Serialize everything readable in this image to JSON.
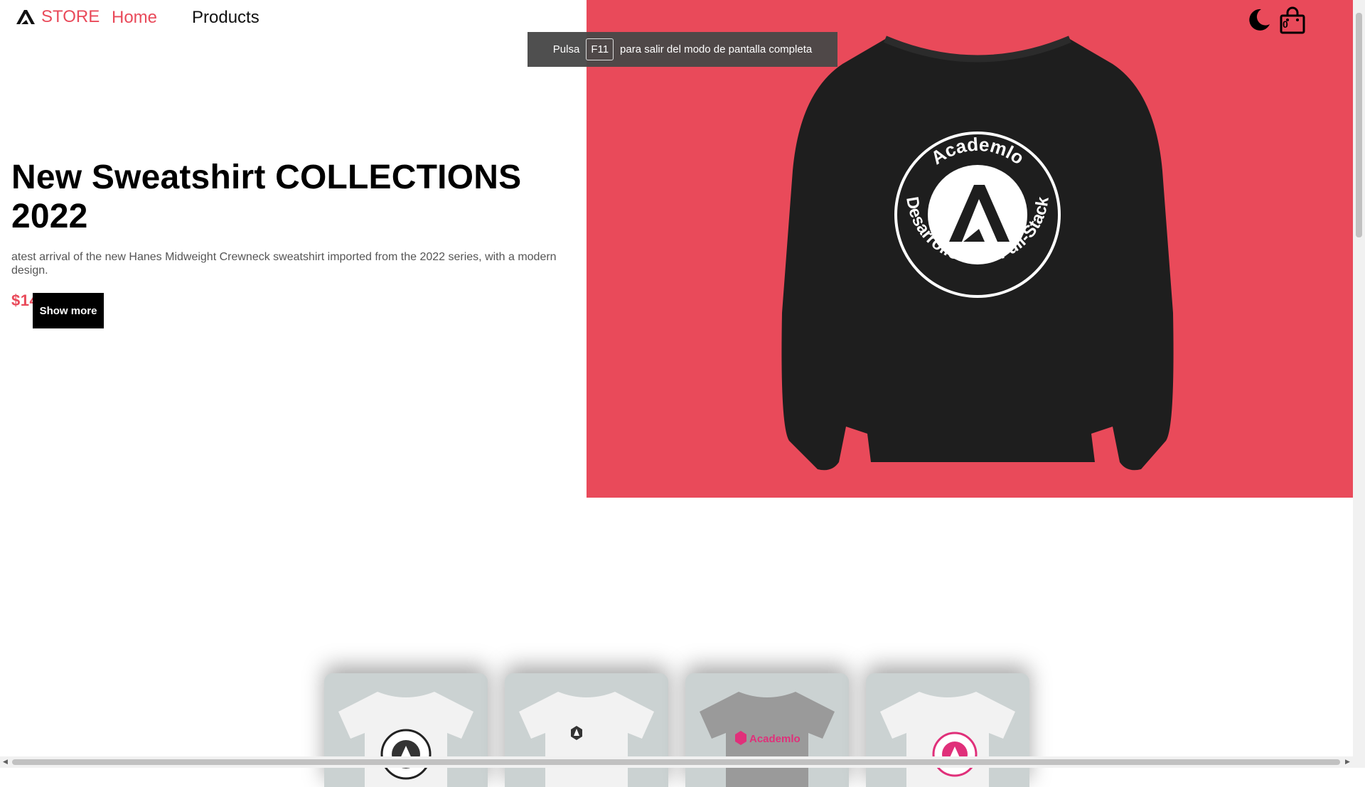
{
  "header": {
    "brand_label": "STORE",
    "nav": {
      "home": "Home",
      "products": "Products"
    },
    "cart_count": "0",
    "icons": {
      "theme_toggle": "moon-icon",
      "cart": "shopping-bag-icon",
      "logo": "academlo-logo-icon"
    }
  },
  "toast": {
    "before": "Pulsa",
    "key": "F11",
    "after": "para salir del modo de pantalla completa"
  },
  "hero": {
    "title": "New Sweatshirt COLLECTIONS 2022",
    "description": "atest arrival of the new Hanes Midweight Crewneck sweatshirt imported from the 2022 series, with a modern design.",
    "price": "$14.00",
    "button_label": "Show more",
    "image_text": {
      "top": "Academlo",
      "bottom": "Desarrollo Web Full-Stack"
    }
  },
  "products": [
    {
      "name": "white-tshirt-circle-logo",
      "shirt_color": "#f2f2f2",
      "print": "circle-dark"
    },
    {
      "name": "white-tshirt-small-logo",
      "shirt_color": "#f2f2f2",
      "print": "small-logo"
    },
    {
      "name": "gray-tshirt-academlo",
      "shirt_color": "#9a9a9a",
      "print": "academlo-text",
      "print_text": "Academlo"
    },
    {
      "name": "white-tshirt-pink-circle",
      "shirt_color": "#f2f2f2",
      "print": "circle-pink"
    }
  ],
  "colors": {
    "accent": "#e94a5a",
    "hero_bg": "#e94a5a",
    "card_bg": "#cbd2d2",
    "button_bg": "#000000"
  }
}
